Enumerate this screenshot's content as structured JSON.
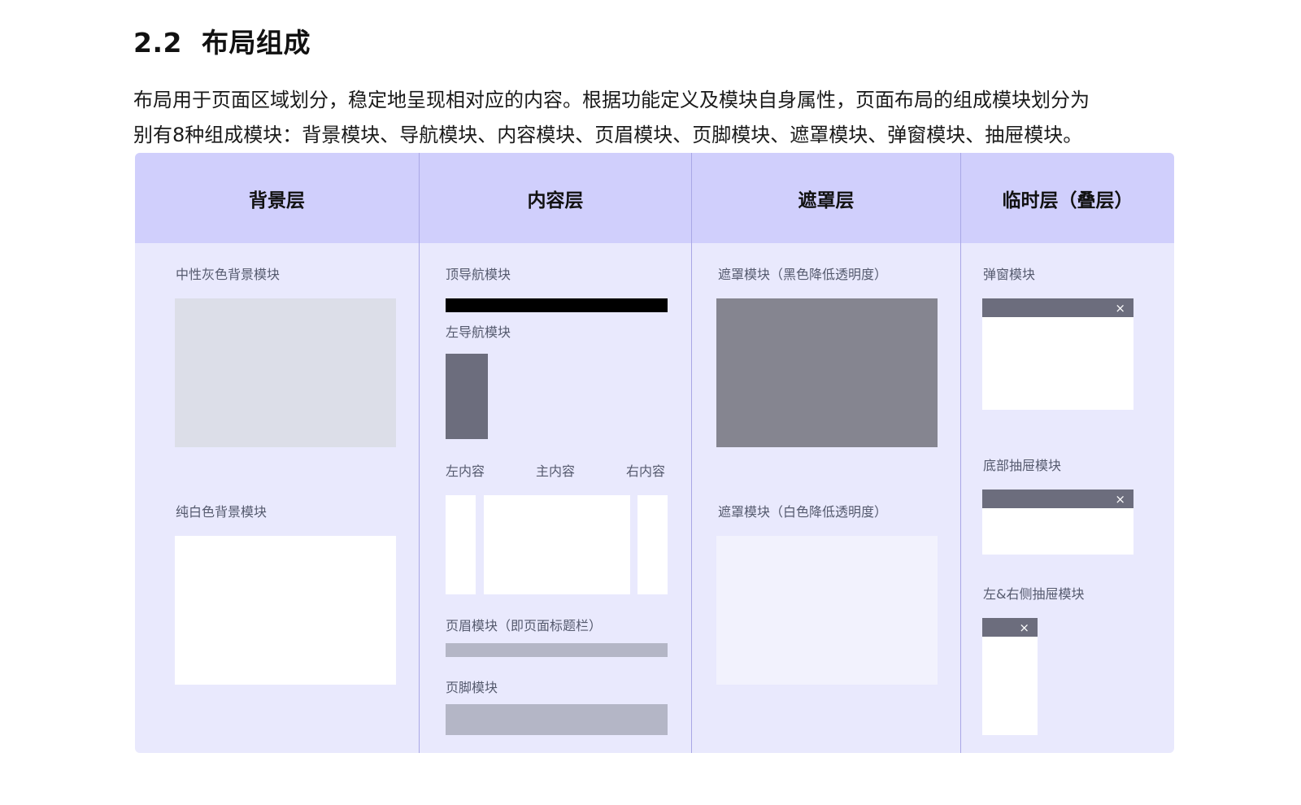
{
  "heading": {
    "number": "2.2",
    "title": "布局组成"
  },
  "intro": {
    "line1": "布局用于页面区域划分，稳定地呈现相对应的内容。根据功能定义及模块自身属性，页面布局的组成模块划分为",
    "line2": "别有8种组成模块：背景模块、导航模块、内容模块、页眉模块、页脚模块、遮罩模块、弹窗模块、抽屉模块。"
  },
  "columns": {
    "background": {
      "title": "背景层",
      "gray_label": "中性灰色背景模块",
      "white_label": "纯白色背景模块"
    },
    "content": {
      "title": "内容层",
      "top_nav_label": "顶导航模块",
      "left_nav_label": "左导航模块",
      "left_content_label": "左内容",
      "main_content_label": "主内容",
      "right_content_label": "右内容",
      "header_label": "页眉模块（即页面标题栏）",
      "footer_label": "页脚模块"
    },
    "mask": {
      "title": "遮罩层",
      "dark_label": "遮罩模块（黑色降低透明度）",
      "light_label": "遮罩模块（白色降低透明度）"
    },
    "overlay": {
      "title": "临时层（叠层）",
      "dialog_label": "弹窗模块",
      "bottom_drawer_label": "底部抽屉模块",
      "side_drawer_label": "左&右侧抽屉模块",
      "close_glyph": "×"
    }
  },
  "colors": {
    "panel_bg": "#e9e9fd",
    "header_bg": "#d0cffc",
    "divider": "#a9a7e6",
    "gray_block": "#dcdee8",
    "dark_bar": "#6c6d7d",
    "mask_dark": "#858590",
    "mask_light": "#f2f2fd",
    "silver_bar": "#b4b6c6"
  }
}
